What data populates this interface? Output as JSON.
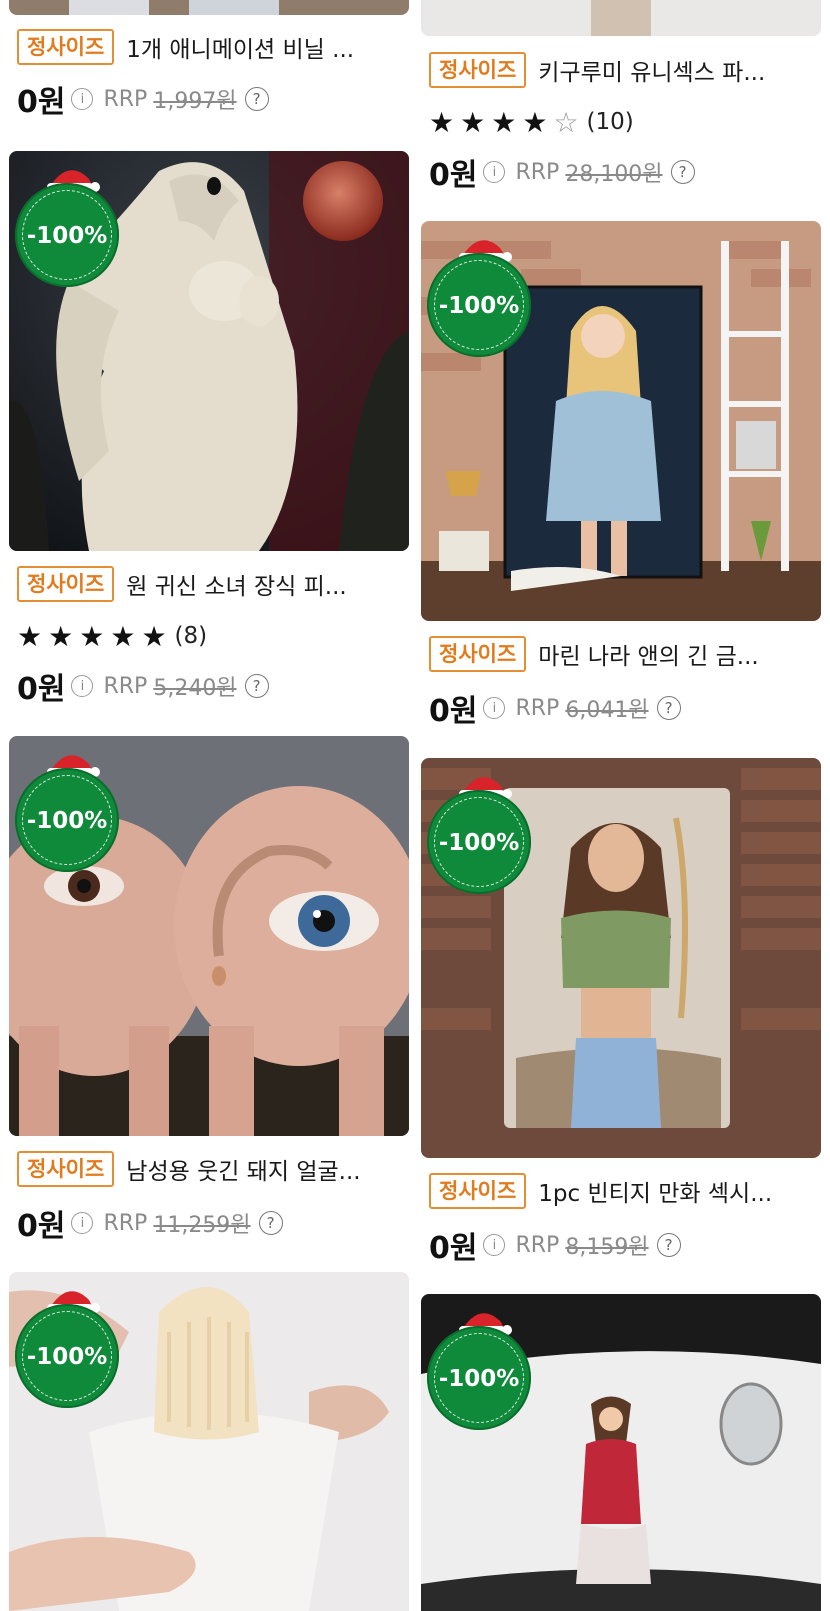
{
  "colors": {
    "accent_orange": "#e07b1e",
    "badge_green": "#0f8a3a",
    "text_dark": "#111111",
    "muted_gray": "#8a8a8a"
  },
  "left_column": [
    {
      "size_tag": "정사이즈",
      "title": "1개 애니메이션 비닐 ...",
      "price": "0원",
      "rrp_label": "RRP",
      "rrp_value": "1,997원"
    },
    {
      "discount_badge": "-100%",
      "image_desc_icon": "ghost-statue-image",
      "size_tag": "정사이즈",
      "title": "원 귀신 소녀 장식 피...",
      "rating_stars": 5,
      "review_count": "(8)",
      "price": "0원",
      "rrp_label": "RRP",
      "rrp_value": "5,240원"
    },
    {
      "discount_badge": "-100%",
      "image_desc_icon": "pig-eye-image",
      "size_tag": "정사이즈",
      "title": "남성용 웃긴 돼지 얼굴...",
      "price": "0원",
      "rrp_label": "RRP",
      "rrp_value": "11,259원"
    },
    {
      "discount_badge": "-100%",
      "image_desc_icon": "silicone-product-image"
    }
  ],
  "right_column": [
    {
      "size_tag": "정사이즈",
      "title": "키구루미 유니섹스 파...",
      "rating_stars": 4,
      "review_count": "(10)",
      "price": "0원",
      "rrp_label": "RRP",
      "rrp_value": "28,100원"
    },
    {
      "discount_badge": "-100%",
      "image_desc_icon": "anime-poster-image",
      "size_tag": "정사이즈",
      "title": "마린 나라 앤의 긴 금...",
      "price": "0원",
      "rrp_label": "RRP",
      "rrp_value": "6,041원"
    },
    {
      "discount_badge": "-100%",
      "image_desc_icon": "metal-sign-image",
      "size_tag": "정사이즈",
      "title": "1pc 빈티지 만화 섹시...",
      "price": "0원",
      "rrp_label": "RRP",
      "rrp_value": "8,159원"
    },
    {
      "discount_badge": "-100%",
      "image_desc_icon": "car-decal-image"
    }
  ]
}
